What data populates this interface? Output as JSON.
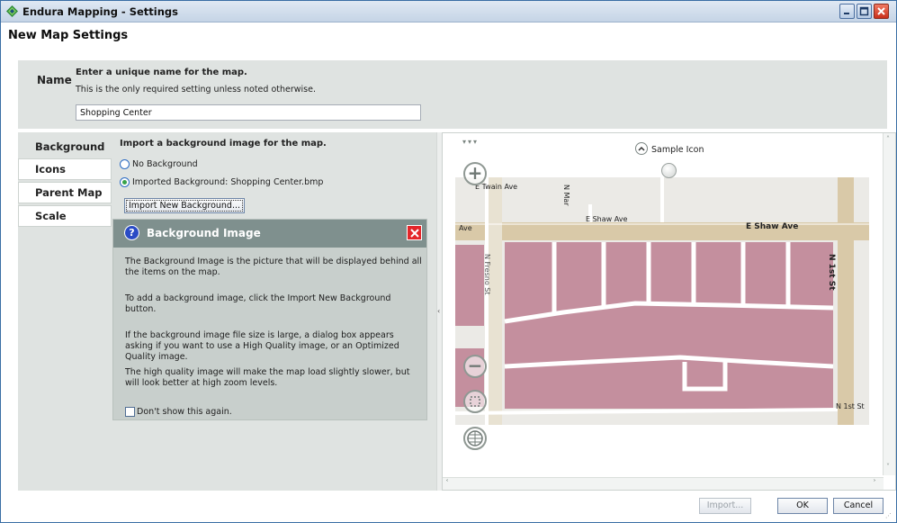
{
  "window": {
    "title": "Endura Mapping - Settings",
    "controls": {
      "minimize": "minimize",
      "maximize": "maximize",
      "close": "close"
    }
  },
  "page": {
    "title": "New Map Settings"
  },
  "name_section": {
    "label": "Name",
    "heading": "Enter a unique name for the map.",
    "subtext": "This is the only required setting unless noted otherwise.",
    "value": "Shopping Center"
  },
  "tabs": [
    {
      "label": "Background",
      "active": true
    },
    {
      "label": "Icons",
      "active": false
    },
    {
      "label": "Parent Map",
      "active": false
    },
    {
      "label": "Scale",
      "active": false
    }
  ],
  "background": {
    "heading": "Import a background image for the map.",
    "options": [
      {
        "label": "No Background",
        "selected": false
      },
      {
        "label": "Imported Background: Shopping Center.bmp",
        "selected": true
      }
    ],
    "import_button": "Import New Background..."
  },
  "help": {
    "title": "Background Image",
    "paragraphs": [
      "The Background Image is the picture that will be displayed behind all the items on the map.",
      "To add a background image, click the Import New Background button.",
      "If the background image file size is large, a dialog box appears asking if you want to use a High Quality image, or an Optimized Quality image.",
      "The high quality image will make the map load slightly slower, but will look better at high zoom levels."
    ],
    "dont_show": "Don't show this again."
  },
  "map": {
    "sample_icon_label": "Sample Icon",
    "streets": {
      "e_shaw_ave_upper": "E Shaw Ave",
      "e_shaw_ave_right": "E Shaw Ave",
      "ave_left": "Ave",
      "twain_ave": "E Twain Ave",
      "n_fresno_st": "N Fresno St",
      "n_1st_st_upper": "N 1st St",
      "n_1st_st_lower": "N 1st St",
      "n_maple": "N Mar"
    },
    "colors": {
      "building": "#c48f9e",
      "road": "#d9c9a8",
      "ground": "#ebeae6"
    },
    "tools": [
      "zoom-in",
      "zoom-out",
      "fit-to-screen",
      "globe"
    ]
  },
  "footer": {
    "import": "Import...",
    "ok": "OK",
    "cancel": "Cancel"
  }
}
